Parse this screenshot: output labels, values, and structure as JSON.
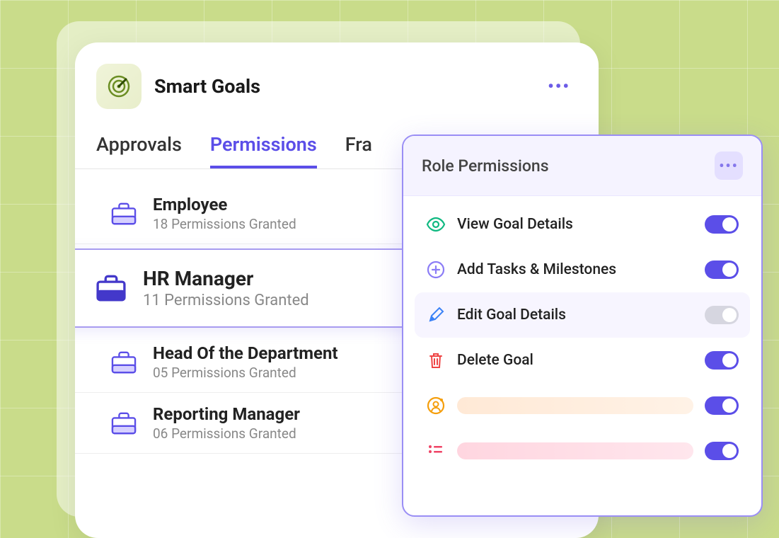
{
  "app": {
    "title": "Smart Goals"
  },
  "tabs": [
    {
      "label": "Approvals",
      "active": false
    },
    {
      "label": "Permissions",
      "active": true
    },
    {
      "label": "Fra",
      "active": false
    }
  ],
  "roles": [
    {
      "name": "Employee",
      "sub": "18 Permissions Granted",
      "selected": false
    },
    {
      "name": "HR Manager",
      "sub": "11 Permissions Granted",
      "selected": true
    },
    {
      "name": "Head Of the Department",
      "sub": "05 Permissions Granted",
      "selected": false
    },
    {
      "name": "Reporting Manager",
      "sub": "06 Permissions Granted",
      "selected": false
    }
  ],
  "permissionsPanel": {
    "title": "Role Permissions",
    "items": [
      {
        "icon": "eye",
        "label": "View Goal Details",
        "on": true,
        "muted": false
      },
      {
        "icon": "plus",
        "label": "Add Tasks & Milestones",
        "on": true,
        "muted": false
      },
      {
        "icon": "pen",
        "label": "Edit Goal Details",
        "on": false,
        "muted": true
      },
      {
        "icon": "trash",
        "label": "Delete Goal",
        "on": true,
        "muted": false
      },
      {
        "icon": "user-badge",
        "placeholder": true,
        "barColor": "#ffe9d6",
        "on": true
      },
      {
        "icon": "list",
        "placeholder": true,
        "barColor": "#ffd6e0",
        "on": true
      }
    ]
  }
}
